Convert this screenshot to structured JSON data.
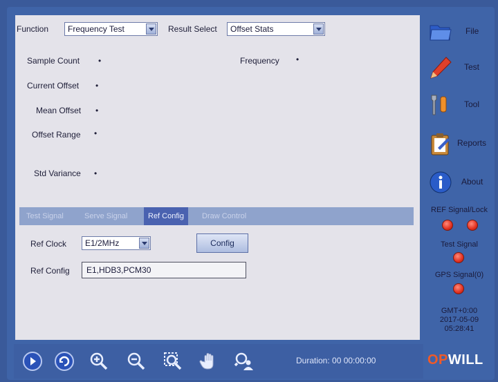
{
  "header": {
    "function_label": "Function",
    "function_value": "Frequency Test",
    "result_label": "Result Select",
    "result_value": "Offset Stats"
  },
  "stats": {
    "sample_count": "Sample Count",
    "frequency": "Frequency",
    "current_offset": "Current Offset",
    "mean_offset": "Mean Offset",
    "offset_range": "Offset Range",
    "std_variance": "Std Variance",
    "dot": "•"
  },
  "tabs": [
    "Test Signal",
    "Serve Signal",
    "Ref Config",
    "Draw Control"
  ],
  "ref": {
    "clock_label": "Ref Clock",
    "clock_value": "E1/2MHz",
    "config_button": "Config",
    "config_label": "Ref Config",
    "config_value": "E1,HDB3,PCM30"
  },
  "sidebar": {
    "file": "File",
    "test": "Test",
    "tool": "Tool",
    "reports": "Reports",
    "about": "About",
    "ref_signal": "REF Signal/Lock",
    "test_signal": "Test Signal",
    "gps_signal": "GPS Signal(0)",
    "tz": "GMT+0:00",
    "date": "2017-05-09",
    "time": "05:28:41"
  },
  "toolbar": {
    "duration": "Duration: 00  00:00:00"
  },
  "logo": {
    "op": "OP",
    "will": "WILL"
  },
  "colors": {
    "panel": "#e4e3ea",
    "frame": "#3f64a8",
    "tab_active": "#4a62b0",
    "led_red": "#e23020"
  }
}
